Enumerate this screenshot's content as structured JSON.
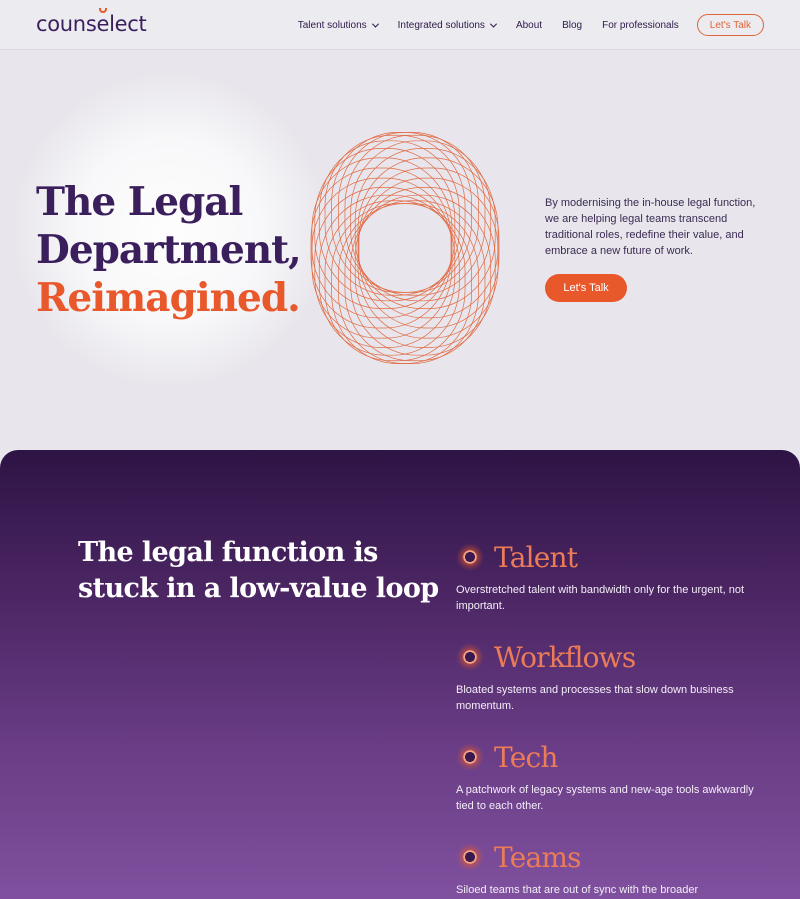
{
  "brand": {
    "logo_prefix": "couns",
    "logo_e": "e",
    "logo_suffix": "lect"
  },
  "nav": {
    "items": [
      {
        "label": "Talent solutions",
        "dropdown": true
      },
      {
        "label": "Integrated solutions",
        "dropdown": true
      },
      {
        "label": "About",
        "dropdown": false
      },
      {
        "label": "Blog",
        "dropdown": false
      },
      {
        "label": "For professionals",
        "dropdown": false
      }
    ],
    "cta": "Let's Talk"
  },
  "hero": {
    "title_line1": "The Legal",
    "title_line2": "Department,",
    "title_accent": "Reimagined.",
    "description": "By modernising the in-house legal function, we are helping legal teams transcend traditional roles, redefine their value, and embrace a new future of work.",
    "cta": "Let's Talk"
  },
  "loop_section": {
    "title": "The legal function is stuck in a low-value loop",
    "items": [
      {
        "name": "Talent",
        "desc": "Overstretched talent with bandwidth only for the urgent, not important."
      },
      {
        "name": "Workflows",
        "desc": "Bloated systems and processes that slow down business momentum."
      },
      {
        "name": "Tech",
        "desc": "A patchwork of legacy systems and new-age tools awkwardly tied to each other."
      },
      {
        "name": "Teams",
        "desc": "Siloed teams that are out of sync with the broader"
      }
    ]
  },
  "colors": {
    "brand_purple": "#3a1f5c",
    "accent_orange": "#e8582b",
    "page_bg": "#e8e6ec"
  }
}
